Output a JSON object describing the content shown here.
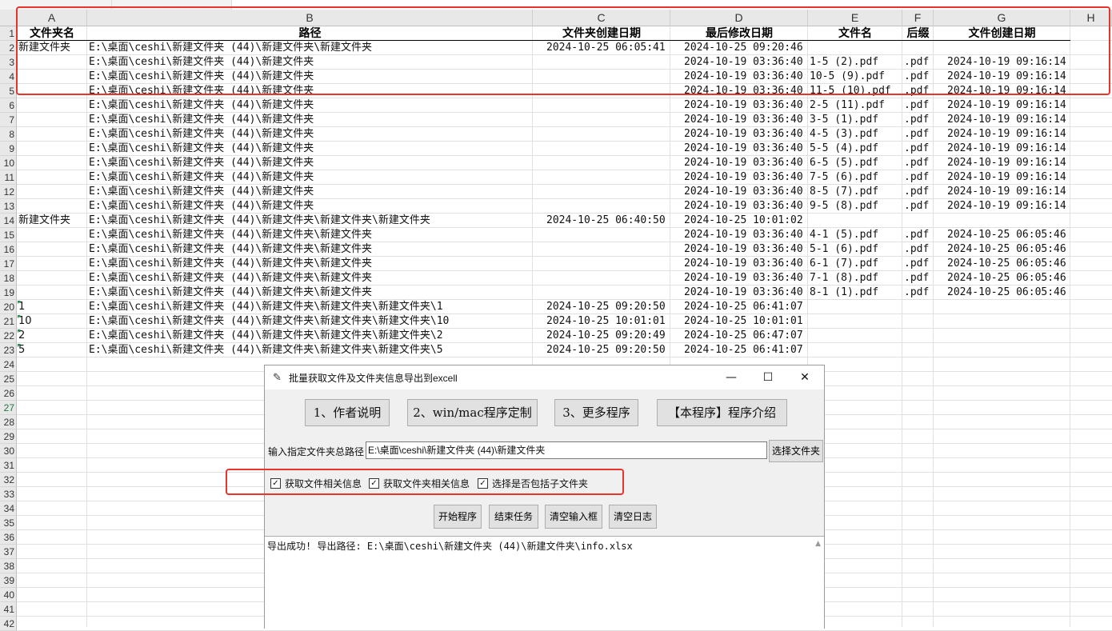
{
  "spreadsheet": {
    "columns": [
      "A",
      "B",
      "C",
      "D",
      "E",
      "F",
      "G",
      "H"
    ],
    "selected_row": "27",
    "headers": [
      "文件夹名",
      "路径",
      "文件夹创建日期",
      "最后修改日期",
      "文件名",
      "后缀",
      "文件创建日期"
    ],
    "rows": [
      {
        "n": "2",
        "a": "新建文件夹",
        "b": "E:\\桌面\\ceshi\\新建文件夹 (44)\\新建文件夹\\新建文件夹",
        "c": "2024-10-25 06:05:41",
        "d": "2024-10-25 09:20:46",
        "e": "",
        "f": "",
        "g": ""
      },
      {
        "n": "3",
        "a": "",
        "b": "E:\\桌面\\ceshi\\新建文件夹 (44)\\新建文件夹",
        "c": "",
        "d": "2024-10-19 03:36:40",
        "e": "1-5 (2).pdf",
        "f": ".pdf",
        "g": "2024-10-19 09:16:14"
      },
      {
        "n": "4",
        "a": "",
        "b": "E:\\桌面\\ceshi\\新建文件夹 (44)\\新建文件夹",
        "c": "",
        "d": "2024-10-19 03:36:40",
        "e": "10-5 (9).pdf",
        "f": ".pdf",
        "g": "2024-10-19 09:16:14"
      },
      {
        "n": "5",
        "a": "",
        "b": "E:\\桌面\\ceshi\\新建文件夹 (44)\\新建文件夹",
        "c": "",
        "d": "2024-10-19 03:36:40",
        "e": "11-5 (10).pdf",
        "f": ".pdf",
        "g": "2024-10-19 09:16:14"
      },
      {
        "n": "6",
        "a": "",
        "b": "E:\\桌面\\ceshi\\新建文件夹 (44)\\新建文件夹",
        "c": "",
        "d": "2024-10-19 03:36:40",
        "e": "2-5 (11).pdf",
        "f": ".pdf",
        "g": "2024-10-19 09:16:14"
      },
      {
        "n": "7",
        "a": "",
        "b": "E:\\桌面\\ceshi\\新建文件夹 (44)\\新建文件夹",
        "c": "",
        "d": "2024-10-19 03:36:40",
        "e": "3-5 (1).pdf",
        "f": ".pdf",
        "g": "2024-10-19 09:16:14"
      },
      {
        "n": "8",
        "a": "",
        "b": "E:\\桌面\\ceshi\\新建文件夹 (44)\\新建文件夹",
        "c": "",
        "d": "2024-10-19 03:36:40",
        "e": "4-5 (3).pdf",
        "f": ".pdf",
        "g": "2024-10-19 09:16:14"
      },
      {
        "n": "9",
        "a": "",
        "b": "E:\\桌面\\ceshi\\新建文件夹 (44)\\新建文件夹",
        "c": "",
        "d": "2024-10-19 03:36:40",
        "e": "5-5 (4).pdf",
        "f": ".pdf",
        "g": "2024-10-19 09:16:14"
      },
      {
        "n": "10",
        "a": "",
        "b": "E:\\桌面\\ceshi\\新建文件夹 (44)\\新建文件夹",
        "c": "",
        "d": "2024-10-19 03:36:40",
        "e": "6-5 (5).pdf",
        "f": ".pdf",
        "g": "2024-10-19 09:16:14"
      },
      {
        "n": "11",
        "a": "",
        "b": "E:\\桌面\\ceshi\\新建文件夹 (44)\\新建文件夹",
        "c": "",
        "d": "2024-10-19 03:36:40",
        "e": "7-5 (6).pdf",
        "f": ".pdf",
        "g": "2024-10-19 09:16:14"
      },
      {
        "n": "12",
        "a": "",
        "b": "E:\\桌面\\ceshi\\新建文件夹 (44)\\新建文件夹",
        "c": "",
        "d": "2024-10-19 03:36:40",
        "e": "8-5 (7).pdf",
        "f": ".pdf",
        "g": "2024-10-19 09:16:14"
      },
      {
        "n": "13",
        "a": "",
        "b": "E:\\桌面\\ceshi\\新建文件夹 (44)\\新建文件夹",
        "c": "",
        "d": "2024-10-19 03:36:40",
        "e": "9-5 (8).pdf",
        "f": ".pdf",
        "g": "2024-10-19 09:16:14"
      },
      {
        "n": "14",
        "a": "新建文件夹",
        "b": "E:\\桌面\\ceshi\\新建文件夹 (44)\\新建文件夹\\新建文件夹\\新建文件夹",
        "c": "2024-10-25 06:40:50",
        "d": "2024-10-25 10:01:02",
        "e": "",
        "f": "",
        "g": ""
      },
      {
        "n": "15",
        "a": "",
        "b": "E:\\桌面\\ceshi\\新建文件夹 (44)\\新建文件夹\\新建文件夹",
        "c": "",
        "d": "2024-10-19 03:36:40",
        "e": "4-1 (5).pdf",
        "f": ".pdf",
        "g": "2024-10-25 06:05:46"
      },
      {
        "n": "16",
        "a": "",
        "b": "E:\\桌面\\ceshi\\新建文件夹 (44)\\新建文件夹\\新建文件夹",
        "c": "",
        "d": "2024-10-19 03:36:40",
        "e": "5-1 (6).pdf",
        "f": ".pdf",
        "g": "2024-10-25 06:05:46"
      },
      {
        "n": "17",
        "a": "",
        "b": "E:\\桌面\\ceshi\\新建文件夹 (44)\\新建文件夹\\新建文件夹",
        "c": "",
        "d": "2024-10-19 03:36:40",
        "e": "6-1 (7).pdf",
        "f": ".pdf",
        "g": "2024-10-25 06:05:46"
      },
      {
        "n": "18",
        "a": "",
        "b": "E:\\桌面\\ceshi\\新建文件夹 (44)\\新建文件夹\\新建文件夹",
        "c": "",
        "d": "2024-10-19 03:36:40",
        "e": "7-1 (8).pdf",
        "f": ".pdf",
        "g": "2024-10-25 06:05:46"
      },
      {
        "n": "19",
        "a": "",
        "b": "E:\\桌面\\ceshi\\新建文件夹 (44)\\新建文件夹\\新建文件夹",
        "c": "",
        "d": "2024-10-19 03:36:40",
        "e": "8-1 (1).pdf",
        "f": ".pdf",
        "g": "2024-10-25 06:05:46"
      },
      {
        "n": "20",
        "a": "1",
        "b": "E:\\桌面\\ceshi\\新建文件夹 (44)\\新建文件夹\\新建文件夹\\新建文件夹\\1",
        "c": "2024-10-25 09:20:50",
        "d": "2024-10-25 06:41:07",
        "e": "",
        "f": "",
        "g": ""
      },
      {
        "n": "21",
        "a": "10",
        "b": "E:\\桌面\\ceshi\\新建文件夹 (44)\\新建文件夹\\新建文件夹\\新建文件夹\\10",
        "c": "2024-10-25 10:01:01",
        "d": "2024-10-25 10:01:01",
        "e": "",
        "f": "",
        "g": ""
      },
      {
        "n": "22",
        "a": "2",
        "b": "E:\\桌面\\ceshi\\新建文件夹 (44)\\新建文件夹\\新建文件夹\\新建文件夹\\2",
        "c": "2024-10-25 09:20:49",
        "d": "2024-10-25 06:47:07",
        "e": "",
        "f": "",
        "g": ""
      },
      {
        "n": "23",
        "a": "5",
        "b": "E:\\桌面\\ceshi\\新建文件夹 (44)\\新建文件夹\\新建文件夹\\新建文件夹\\5",
        "c": "2024-10-25 09:20:50",
        "d": "2024-10-25 06:41:07",
        "e": "",
        "f": "",
        "g": ""
      }
    ],
    "empty_rows": [
      "24",
      "25",
      "26",
      "27",
      "28",
      "29",
      "30",
      "31",
      "32",
      "33",
      "34",
      "35",
      "36",
      "37",
      "38",
      "39",
      "40",
      "41",
      "42"
    ]
  },
  "dialog": {
    "title": "批量获取文件及文件夹信息导出到excell",
    "minimize": "—",
    "maximize": "☐",
    "close": "✕",
    "top_buttons": [
      "1、作者说明",
      "2、win/mac程序定制",
      "3、更多程序",
      "【本程序】程序介绍"
    ],
    "path_label": "输入指定文件夹总路径",
    "path_value": "E:\\桌面\\ceshi\\新建文件夹 (44)\\新建文件夹",
    "choose_folder": "选择文件夹",
    "checkboxes": [
      {
        "label": "获取文件相关信息",
        "checked": true
      },
      {
        "label": "获取文件夹相关信息",
        "checked": true
      },
      {
        "label": "选择是否包括子文件夹",
        "checked": true
      }
    ],
    "check_mark": "✓",
    "action_buttons": [
      "开始程序",
      "结束任务",
      "清空输入框",
      "清空日志"
    ],
    "log": "导出成功! 导出路径: E:\\桌面\\ceshi\\新建文件夹 (44)\\新建文件夹\\info.xlsx"
  },
  "colors": {
    "highlight_box": "#e8342a",
    "selected_row": "#217346"
  }
}
